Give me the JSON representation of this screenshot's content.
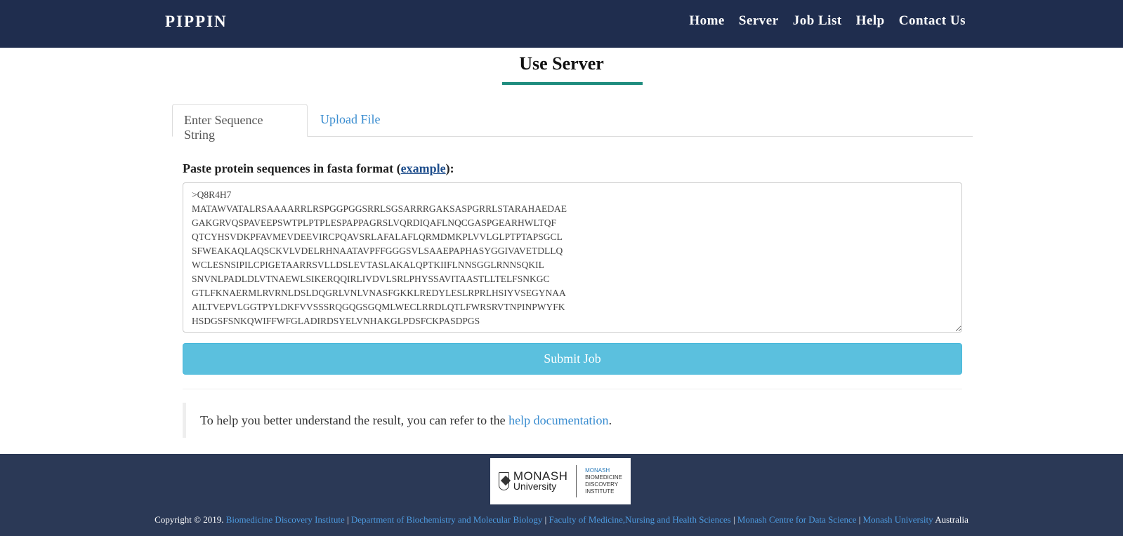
{
  "nav": {
    "brand": "PIPPIN",
    "links": [
      "Home",
      "Server",
      "Job List",
      "Help",
      "Contact Us"
    ]
  },
  "page": {
    "title": "Use Server"
  },
  "tabs": {
    "active": "Enter Sequence String",
    "inactive": "Upload File"
  },
  "form": {
    "label_prefix": "Paste protein sequences in fasta format (",
    "label_link": "example",
    "label_suffix": "):",
    "sequence": ">Q8R4H7\nMATAWVATALRSAAAARRLRSPGGPGGSRRLSGSARRRGAKSASPGRRLSTARAHAEDAE\nGAKGRVQSPAVEEPSWTPLPTPLESPAPPAGRSLVQRDIQAFLNQCGASPGEARHWLTQF\nQTCYHSVDKPFAVMEVDEEVIRCPQAVSRLAFALAFLQRMDMKPLVVLGLPTPTAPSGCL\nSFWEAKAQLAQSCKVLVDELRHNAATAVPFFGGGSVLSAAEPAPHASYGGIVAVETDLLQ\nWCLESNSIPILCPIGETAARRSVLLDSLEVTASLAKALQPTKIIFLNNSGGLRNNSQKIL\nSNVNLPADLDLVTNAEWLSIKERQQIRLIVDVLSRLPHYSSAVITAASTLLTELFSNKGC\nGTLFKNAERMLRVRNLDSLDQGRLVNLVNASFGKKLREDYLESLRPRLHSIYVSEGYNAA\nAILTVEPVLGGTPYLDKFVVSSSRQGQGSGQMLWECLRRDLQTLFWRSRVTNPINPWYFK\nHSDGSFSNKQWIFFWFGLADIRDSYELVNHAKGLPDSFCKPASDPGS",
    "submit_label": "Submit Job"
  },
  "help": {
    "text_prefix": "To help you better understand the result, you can refer to the ",
    "link": "help documentation",
    "text_suffix": "."
  },
  "footer": {
    "logo": {
      "monash": "MONASH",
      "university": "University",
      "bdi_line1": "MONASH",
      "bdi_line2": "BIOMEDICINE",
      "bdi_line3": "DISCOVERY",
      "bdi_line4": "INSTITUTE"
    },
    "copyright_prefix": "Copyright © 2019.",
    "links": [
      "Biomedicine Discovery Institute",
      "Department of Biochemistry and Molecular Biology",
      "Faculty of Medicine,Nursing and Health Sciences",
      "Monash Centre for Data Science",
      "Monash University"
    ],
    "separator": "|",
    "suffix": "Australia"
  },
  "colors": {
    "navbar": "#1f2d4e",
    "footer": "#2b3956",
    "accent_underline": "#1e8c7e",
    "submit": "#5bc0de",
    "link": "#3a8dd0"
  }
}
